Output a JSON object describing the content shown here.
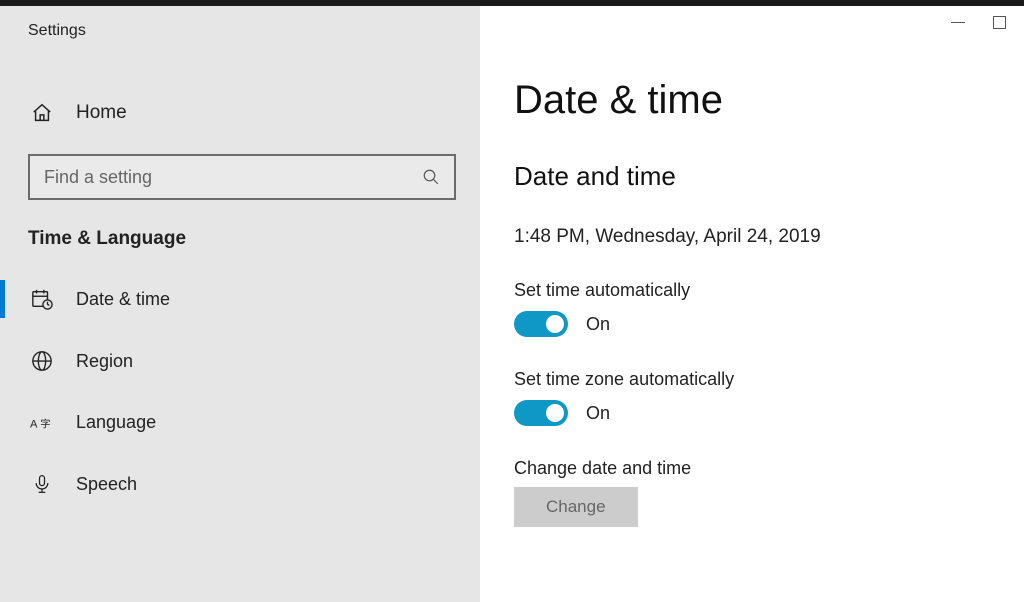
{
  "app_title": "Settings",
  "sidebar": {
    "home_label": "Home",
    "search_placeholder": "Find a setting",
    "section_title": "Time & Language",
    "items": [
      {
        "label": "Date & time",
        "icon": "calendar-clock-icon",
        "active": true
      },
      {
        "label": "Region",
        "icon": "globe-icon",
        "active": false
      },
      {
        "label": "Language",
        "icon": "language-icon",
        "active": false
      },
      {
        "label": "Speech",
        "icon": "microphone-icon",
        "active": false
      }
    ]
  },
  "content": {
    "page_title": "Date & time",
    "section_title": "Date and time",
    "current_datetime": "1:48 PM, Wednesday, April 24, 2019",
    "auto_time": {
      "label": "Set time automatically",
      "state_label": "On",
      "on": true
    },
    "auto_tz": {
      "label": "Set time zone automatically",
      "state_label": "On",
      "on": true
    },
    "change": {
      "label": "Change date and time",
      "button_label": "Change"
    }
  }
}
